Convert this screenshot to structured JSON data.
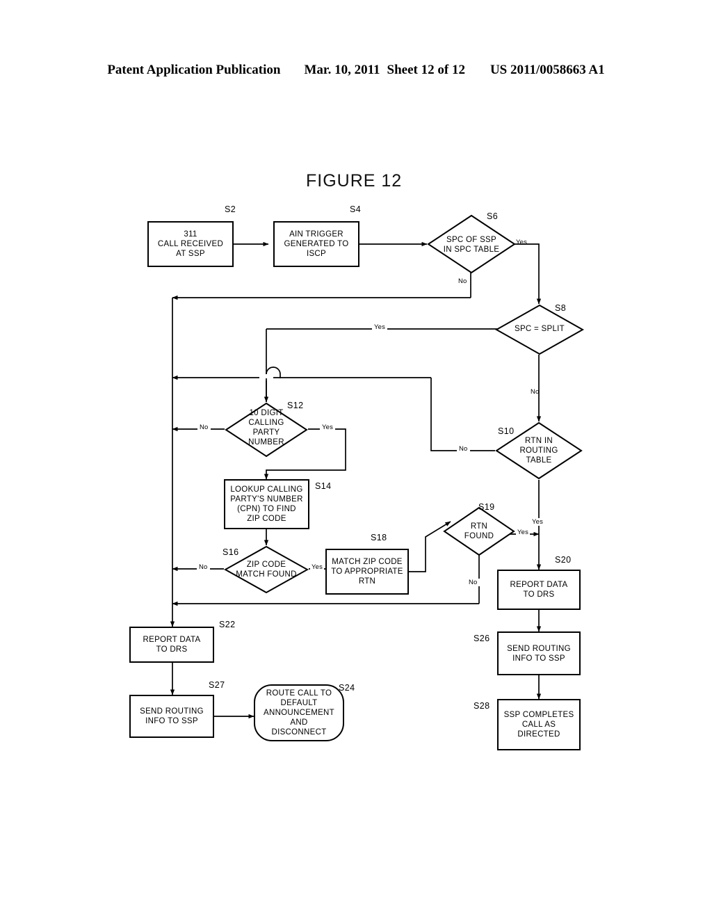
{
  "header": {
    "publication": "Patent Application Publication",
    "date": "Mar. 10, 2011",
    "sheet": "Sheet 12 of 12",
    "number": "US 2011/0058663 A1"
  },
  "figure": {
    "title": "FIGURE 12"
  },
  "nodes": [
    {
      "id": "S2",
      "tag": "S2",
      "shape": "box",
      "text": "311\nCALL RECEIVED\nAT SSP"
    },
    {
      "id": "S4",
      "tag": "S4",
      "shape": "box",
      "text": "AIN TRIGGER\nGENERATED TO\nISCP"
    },
    {
      "id": "S6",
      "tag": "S6",
      "shape": "diamond",
      "text": "SPC OF SSP\nIN SPC TABLE"
    },
    {
      "id": "S8",
      "tag": "S8",
      "shape": "diamond",
      "text": "SPC = SPLIT"
    },
    {
      "id": "S12",
      "tag": "S12",
      "shape": "diamond",
      "text": "10 DIGIT\nCALLING\nPARTY\nNUMBER"
    },
    {
      "id": "S10",
      "tag": "S10",
      "shape": "diamond",
      "text": "RTN IN\nROUTING\nTABLE"
    },
    {
      "id": "S14",
      "tag": "S14",
      "shape": "box",
      "text": "LOOKUP CALLING\nPARTY'S NUMBER\n(CPN) TO FIND\nZIP CODE"
    },
    {
      "id": "S16",
      "tag": "S16",
      "shape": "diamond",
      "text": "ZIP CODE\nMATCH FOUND"
    },
    {
      "id": "S18",
      "tag": "S18",
      "shape": "box",
      "text": "MATCH ZIP CODE\nTO APPROPRIATE\nRTN"
    },
    {
      "id": "S19",
      "tag": "S19",
      "shape": "diamond",
      "text": "RTN\nFOUND"
    },
    {
      "id": "S20",
      "tag": "S20",
      "shape": "box",
      "text": "REPORT DATA\nTO DRS"
    },
    {
      "id": "S22",
      "tag": "S22",
      "shape": "box",
      "text": "REPORT DATA\nTO DRS"
    },
    {
      "id": "S26",
      "tag": "S26",
      "shape": "box",
      "text": "SEND ROUTING\nINFO TO SSP"
    },
    {
      "id": "S27",
      "tag": "S27",
      "shape": "box",
      "text": "SEND ROUTING\nINFO TO SSP"
    },
    {
      "id": "S24",
      "tag": "S24",
      "shape": "rounded",
      "text": "ROUTE CALL TO\nDEFAULT\nANNOUNCEMENT\nAND\nDISCONNECT"
    },
    {
      "id": "S28",
      "tag": "S28",
      "shape": "box",
      "text": "SSP COMPLETES\nCALL AS\nDIRECTED"
    }
  ],
  "edge_labels": {
    "s6_yes": "Yes",
    "s6_no": "No",
    "s8_yes": "Yes",
    "s8_no": "No",
    "s12_no": "No",
    "s12_yes": "Yes",
    "s10_no": "No",
    "s10_yes": "Yes",
    "s16_no": "No",
    "s16_yes": "Yes",
    "s19_yes": "Yes",
    "s19_no": "No"
  },
  "colors": {
    "ink": "#000000",
    "paper": "#ffffff"
  }
}
